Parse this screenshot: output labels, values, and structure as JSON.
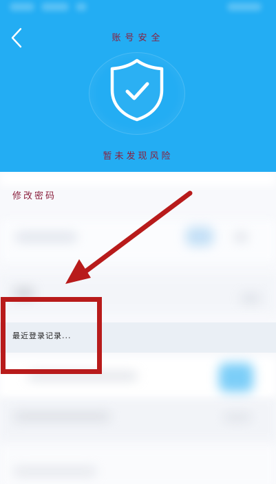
{
  "header": {
    "title": "账号安全",
    "status": "暂未发现风险",
    "background_color": "#23adf3",
    "icons": {
      "back": "chevron-left-icon",
      "shield": "shield-check-icon"
    }
  },
  "list": {
    "change_password": "修改密码",
    "login_record": "最近登录记录..."
  },
  "annotation": {
    "arrow_color": "#b81b1b",
    "box_color": "#b81b1b"
  }
}
